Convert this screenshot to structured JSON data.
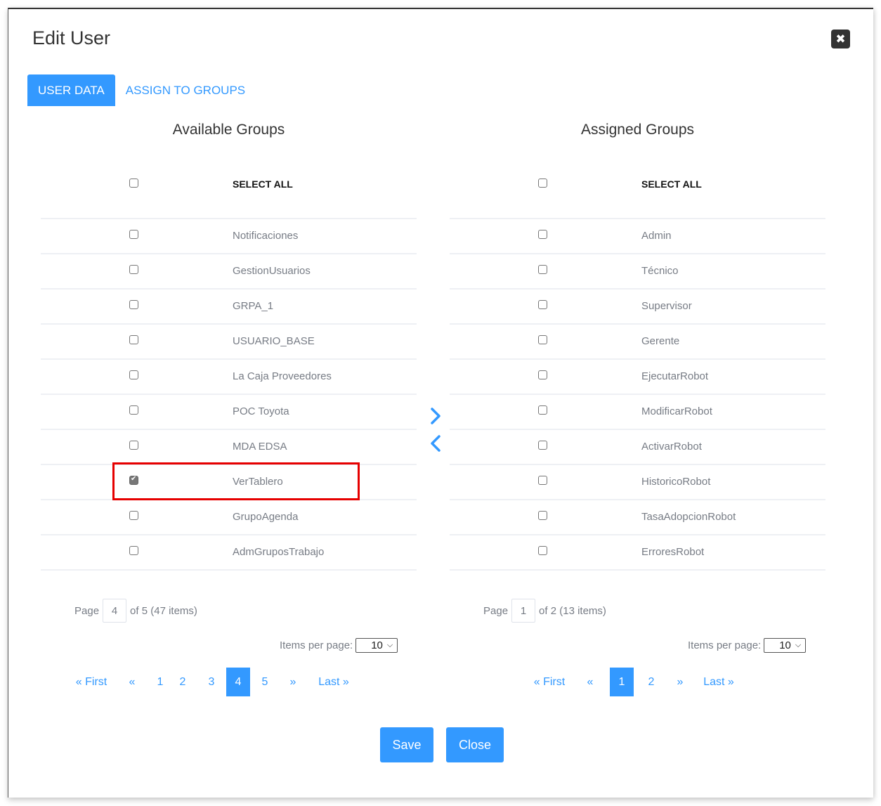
{
  "dialog": {
    "title": "Edit User",
    "close_icon": "close-icon"
  },
  "tabs": [
    {
      "label": "USER DATA",
      "active": true
    },
    {
      "label": "ASSIGN TO GROUPS",
      "active": false
    }
  ],
  "available": {
    "title": "Available Groups",
    "select_all_label": "SELECT ALL",
    "items": [
      {
        "label": "Notificaciones",
        "checked": false
      },
      {
        "label": "GestionUsuarios",
        "checked": false
      },
      {
        "label": "GRPA_1",
        "checked": false
      },
      {
        "label": "USUARIO_BASE",
        "checked": false
      },
      {
        "label": "La Caja Proveedores",
        "checked": false
      },
      {
        "label": "POC Toyota",
        "checked": false
      },
      {
        "label": "MDA EDSA",
        "checked": false
      },
      {
        "label": "VerTablero",
        "checked": true
      },
      {
        "label": "GrupoAgenda",
        "checked": false
      },
      {
        "label": "AdmGruposTrabajo",
        "checked": false
      }
    ],
    "pager": {
      "page_label": "Page",
      "current_page": "4",
      "summary": "of 5 (47 items)",
      "items_per_page_label": "Items per page:",
      "items_per_page": "10",
      "links": [
        "« First",
        "«",
        "1",
        "2",
        "3",
        "4",
        "5",
        "»",
        "Last »"
      ],
      "active": "4"
    }
  },
  "assigned": {
    "title": "Assigned Groups",
    "select_all_label": "SELECT ALL",
    "items": [
      {
        "label": "Admin",
        "checked": false
      },
      {
        "label": "Técnico",
        "checked": false
      },
      {
        "label": "Supervisor",
        "checked": false
      },
      {
        "label": "Gerente",
        "checked": false
      },
      {
        "label": "EjecutarRobot",
        "checked": false
      },
      {
        "label": "ModificarRobot",
        "checked": false
      },
      {
        "label": "ActivarRobot",
        "checked": false
      },
      {
        "label": "HistoricoRobot",
        "checked": false
      },
      {
        "label": "TasaAdopcionRobot",
        "checked": false
      },
      {
        "label": "ErroresRobot",
        "checked": false
      }
    ],
    "pager": {
      "page_label": "Page",
      "current_page": "1",
      "summary": "of 2 (13 items)",
      "items_per_page_label": "Items per page:",
      "items_per_page": "10",
      "links": [
        "« First",
        "«",
        "1",
        "2",
        "»",
        "Last »"
      ],
      "active": "1"
    }
  },
  "transfer": {
    "move_right_icon": "chevron-right-icon",
    "move_left_icon": "chevron-left-icon"
  },
  "footer": {
    "save_label": "Save",
    "close_label": "Close"
  },
  "colors": {
    "accent": "#3399ff",
    "highlight": "#e60000",
    "close_bg": "#333333"
  }
}
